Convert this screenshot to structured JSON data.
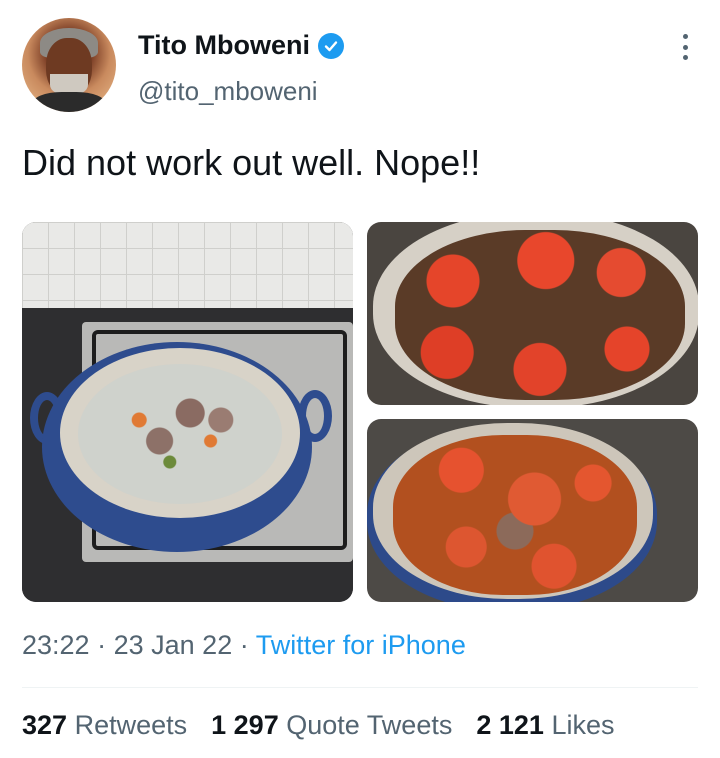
{
  "author": {
    "name": "Tito Mboweni",
    "handle": "@tito_mboweni",
    "verified": true,
    "verified_color": "#1d9bf0"
  },
  "tweet": {
    "text": "Did not work out well. Nope!!"
  },
  "media": [
    {
      "icon": "photo-stew-pot-on-stove"
    },
    {
      "icon": "photo-stew-with-tomatoes"
    },
    {
      "icon": "photo-stew-cooked-sauce"
    }
  ],
  "meta": {
    "time": "23:22",
    "date": "23 Jan 22",
    "separator": "·",
    "source": "Twitter for iPhone"
  },
  "stats": {
    "retweets_count": "327",
    "retweets_label": "Retweets",
    "quotes_count": "1 297",
    "quotes_label": "Quote Tweets",
    "likes_count": "2 121",
    "likes_label": "Likes"
  },
  "colors": {
    "text_primary": "#0f1419",
    "text_secondary": "#536471",
    "link": "#1d9bf0"
  }
}
